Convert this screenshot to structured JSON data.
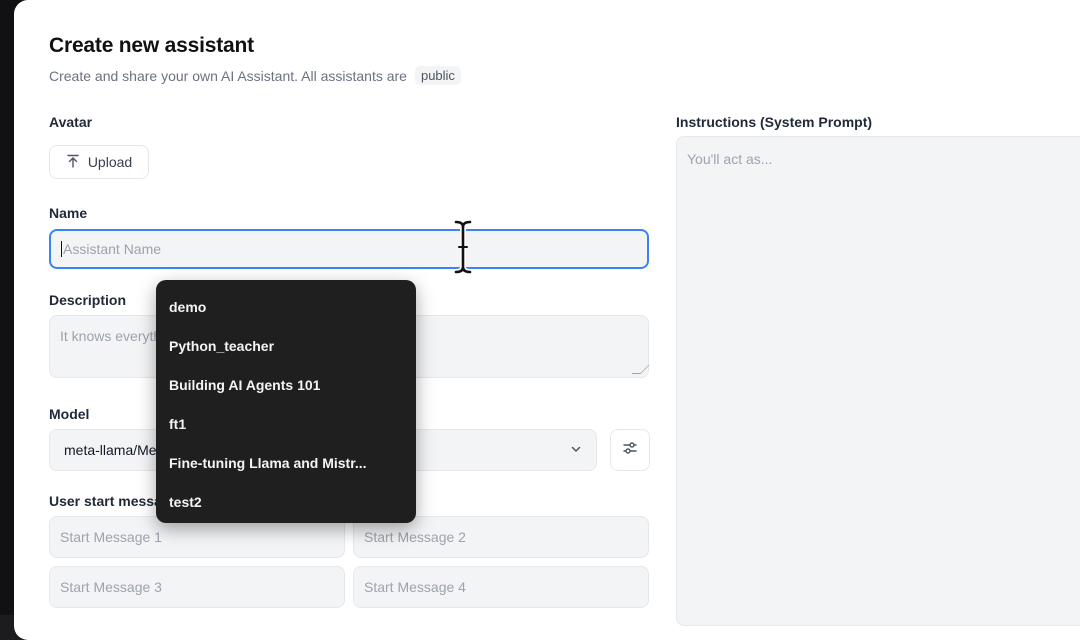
{
  "form": {
    "title": "Create new assistant",
    "subtitle": "Create and share your own AI Assistant. All assistants are",
    "visibility_badge": "public",
    "avatar_label": "Avatar",
    "upload_label": "Upload",
    "name_label": "Name",
    "name_placeholder": "Assistant Name",
    "description_label": "Description",
    "description_placeholder": "It knows everything about python",
    "model_label": "Model",
    "model_value": "meta-llama/Meta-Llama-3.1-70B-Instruct",
    "start_messages_label": "User start messages",
    "start_messages": [
      "Start Message 1",
      "Start Message 2",
      "Start Message 3",
      "Start Message 4"
    ],
    "instructions_label": "Instructions (System Prompt)",
    "instructions_placeholder": "You'll act as..."
  },
  "autocomplete": {
    "items": [
      "demo",
      "Python_teacher",
      "Building AI Agents 101",
      "ft1",
      "Fine-tuning Llama and Mistr...",
      "test2"
    ]
  },
  "icons": {
    "upload": "upload-icon",
    "settings": "sliders-icon",
    "chevron": "chevron-down-icon",
    "cursor": "text-cursor-icon"
  },
  "colors": {
    "focus_border": "#3b82f6",
    "dropdown_bg": "#1f1f1f",
    "field_bg": "#f3f4f6"
  }
}
